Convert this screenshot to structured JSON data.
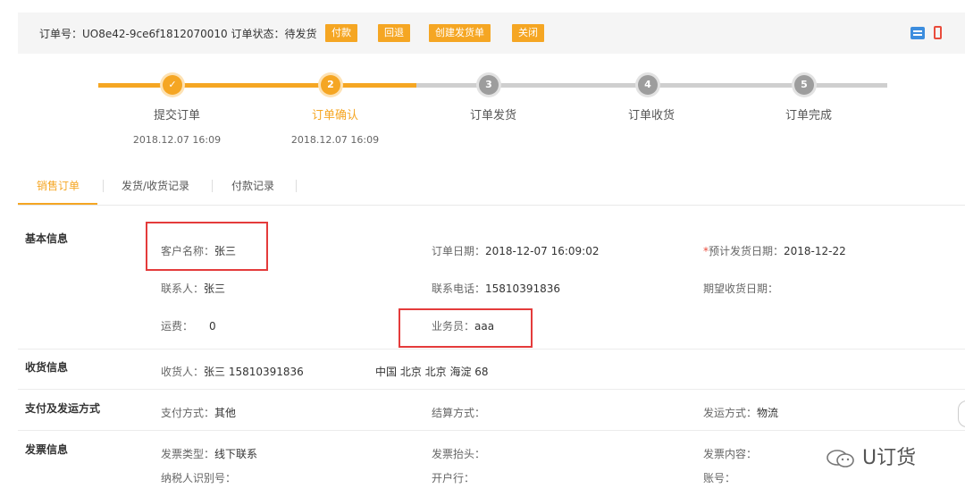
{
  "header": {
    "order_label": "订单号：",
    "order_no": "UO8e42-9ce6f1812070010",
    "status_label": "订单状态：",
    "status_value": "待发货",
    "buttons": [
      "付款",
      "回退",
      "创建发货单",
      "关闭"
    ],
    "icons": [
      "list-icon",
      "mobile-icon"
    ],
    "accent": "#f5a623"
  },
  "steps": [
    {
      "num": "✓",
      "label": "提交订单",
      "time": "2018.12.07 16:09",
      "state": "done"
    },
    {
      "num": "2",
      "label": "订单确认",
      "time": "2018.12.07 16:09",
      "state": "active"
    },
    {
      "num": "3",
      "label": "订单发货",
      "time": "",
      "state": "todo"
    },
    {
      "num": "4",
      "label": "订单收货",
      "time": "",
      "state": "todo"
    },
    {
      "num": "5",
      "label": "订单完成",
      "time": "",
      "state": "todo"
    }
  ],
  "tabs": [
    "销售订单",
    "发货/收货记录",
    "付款记录"
  ],
  "basic": {
    "title": "基本信息",
    "customer_label": "客户名称：",
    "customer_value": "张三",
    "order_date_label": "订单日期：",
    "order_date_value": "2018-12-07 16:09:02",
    "req_mark": "*",
    "ship_date_label": "预计发货日期：",
    "ship_date_value": "2018-12-22",
    "contact_label": "联系人：",
    "contact_value": "张三",
    "phone_label": "联系电话：",
    "phone_value": "15810391836",
    "expect_label": "期望收货日期：",
    "freight_label": "运费：",
    "freight_value": "0",
    "sales_label": "业务员：",
    "sales_value": "aaa"
  },
  "receive": {
    "title": "收货信息",
    "receiver_label": "收货人：",
    "receiver_value": "张三  15810391836",
    "address": "中国 北京 北京 海淀 68"
  },
  "payship": {
    "title": "支付及发运方式",
    "pay_label": "支付方式：",
    "pay_value": "其他",
    "settle_label": "结算方式：",
    "ship_label": "发运方式：",
    "ship_value": "物流"
  },
  "invoice": {
    "title": "发票信息",
    "type_label": "发票类型：",
    "type_value": "线下联系",
    "head_label": "发票抬头：",
    "content_label": "发票内容：",
    "taxid_label": "纳税人识别号：",
    "bank_label": "开户行：",
    "account_label": "账号："
  },
  "watermark": "U订货"
}
